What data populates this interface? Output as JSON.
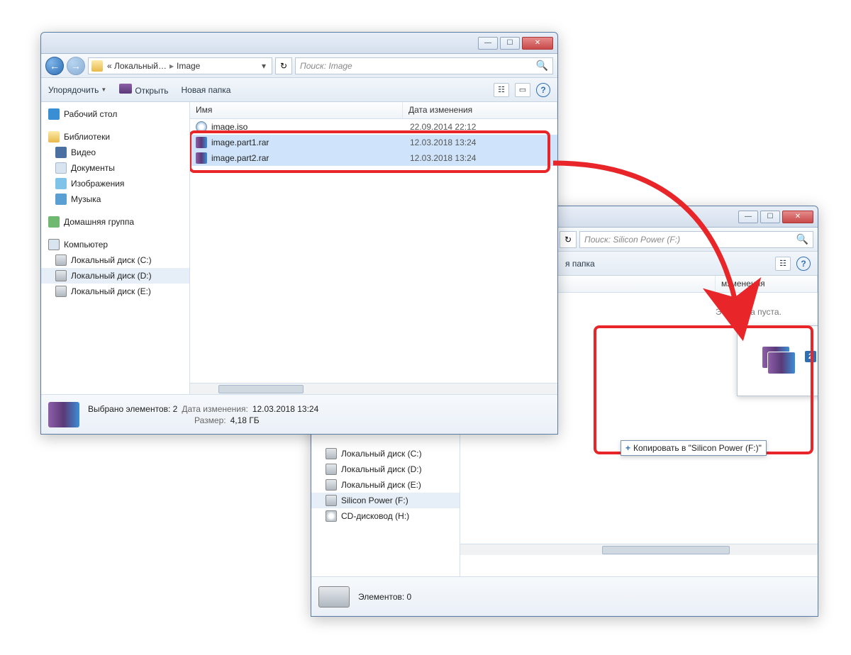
{
  "window1": {
    "titlebar": {
      "min": "—",
      "max": "☐",
      "close": "✕"
    },
    "nav": {
      "back": "←",
      "fwd": "→",
      "crumb_parent": "Локальный…",
      "crumb_current": "Image",
      "refresh": "↻",
      "search_placeholder": "Поиск: Image"
    },
    "toolbar": {
      "organize": "Упорядочить",
      "open": "Открыть",
      "newfolder": "Новая папка",
      "view": "☷",
      "preview": "▭",
      "help": "?"
    },
    "sidebar": {
      "desktop": "Рабочий стол",
      "libraries": "Библиотеки",
      "video": "Видео",
      "documents": "Документы",
      "images": "Изображения",
      "music": "Музыка",
      "homegroup": "Домашняя группа",
      "computer": "Компьютер",
      "disk_c": "Локальный диск (C:)",
      "disk_d": "Локальный диск (D:)",
      "disk_e": "Локальный диск (E:)"
    },
    "columns": {
      "name": "Имя",
      "date": "Дата изменения"
    },
    "files": [
      {
        "name": "image.iso",
        "date": "22.09.2014 22:12",
        "type": "iso",
        "selected": false
      },
      {
        "name": "image.part1.rar",
        "date": "12.03.2018 13:24",
        "type": "rar",
        "selected": true
      },
      {
        "name": "image.part2.rar",
        "date": "12.03.2018 13:24",
        "type": "rar",
        "selected": true
      }
    ],
    "status": {
      "selected_count": "Выбрано элементов: 2",
      "date_label": "Дата изменения:",
      "date_value": "12.03.2018 13:24",
      "size_label": "Размер:",
      "size_value": "4,18 ГБ"
    }
  },
  "window2": {
    "titlebar": {
      "min": "—",
      "max": "☐",
      "close": "✕"
    },
    "nav": {
      "refresh": "↻",
      "search_placeholder": "Поиск: Silicon Power (F:)"
    },
    "toolbar": {
      "newfolder_tail": "я папка",
      "view": "☷",
      "help": "?"
    },
    "columns": {
      "date_tail": "мзменения"
    },
    "empty": "Эта папка пуста.",
    "sidebar": {
      "disk_c": "Локальный диск (C:)",
      "disk_d": "Локальный диск (D:)",
      "disk_e": "Локальный диск (E:)",
      "silicon": "Silicon Power (F:)",
      "cd": "CD-дисковод (H:)"
    },
    "status": {
      "elements": "Элементов: 0"
    },
    "drag": {
      "badge": "2",
      "tooltip_prefix": "+",
      "tooltip_text": "Копировать в \"Silicon Power (F:)\""
    }
  }
}
